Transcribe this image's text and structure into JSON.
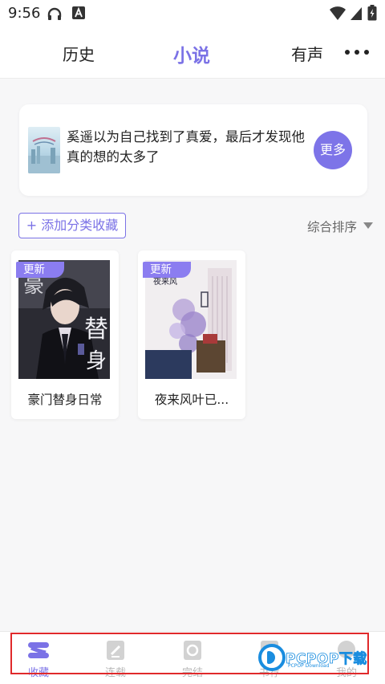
{
  "status_bar": {
    "time": "9:56",
    "icons": [
      "headphones-icon",
      "notification-a-icon",
      "wifi-icon",
      "signal-icon",
      "battery-icon"
    ]
  },
  "top_nav": {
    "tabs": [
      {
        "label": "历史",
        "active": false
      },
      {
        "label": "小说",
        "active": true
      },
      {
        "label": "有声",
        "active": false
      }
    ],
    "menu_icon": "more-dots-icon"
  },
  "banner": {
    "text": "奚遥以为自己找到了真爱，最后才发现他真的想的太多了",
    "more_label": "更多"
  },
  "shelf": {
    "add_category_label": "+ 添加分类收藏",
    "sort_label": "综合排序"
  },
  "books": [
    {
      "title": "豪门替身日常",
      "badge": "更新"
    },
    {
      "title": "夜来风叶已...",
      "badge": "更新"
    }
  ],
  "bottom_nav": {
    "items": [
      {
        "label": "收藏",
        "icon": "bookshelf-icon",
        "active": true
      },
      {
        "label": "连载",
        "icon": "serial-edit-icon",
        "active": false
      },
      {
        "label": "完结",
        "icon": "completed-book-icon",
        "active": false
      },
      {
        "label": "书荐",
        "icon": "recommend-icon",
        "active": false
      },
      {
        "label": "我的",
        "icon": "profile-icon",
        "active": false
      }
    ]
  },
  "watermark": {
    "text": "PCPOP下载",
    "subtext": "PCPOP Download"
  },
  "colors": {
    "accent": "#7b72e6",
    "highlight_box": "#e0292b"
  }
}
